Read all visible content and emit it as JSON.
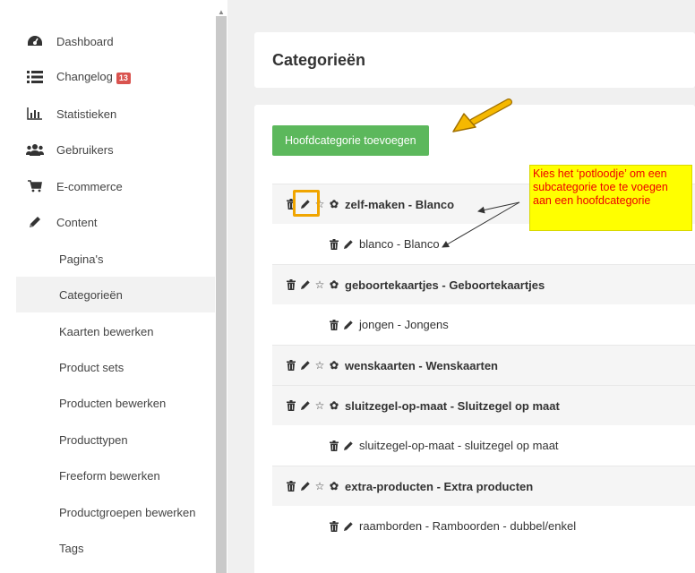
{
  "sidebar": {
    "items": [
      {
        "label": "Dashboard",
        "icon": "dashboard-icon"
      },
      {
        "label": "Changelog",
        "icon": "list-icon",
        "badge": "13"
      },
      {
        "label": "Statistieken",
        "icon": "bar-chart-icon"
      },
      {
        "label": "Gebruikers",
        "icon": "users-icon"
      },
      {
        "label": "E-commerce",
        "icon": "cart-icon"
      },
      {
        "label": "Content",
        "icon": "pencil-icon"
      }
    ],
    "sub_items": [
      {
        "label": "Pagina's"
      },
      {
        "label": "Categorieën",
        "active": true
      },
      {
        "label": "Kaarten bewerken"
      },
      {
        "label": "Product sets"
      },
      {
        "label": "Producten bewerken"
      },
      {
        "label": "Producttypen"
      },
      {
        "label": "Freeform bewerken"
      },
      {
        "label": "Productgroepen bewerken"
      },
      {
        "label": "Tags"
      }
    ]
  },
  "main": {
    "title": "Categorieën",
    "add_button": "Hoofdcategorie toevoegen",
    "categories": [
      {
        "type": "main",
        "label": "zelf-maken - Blanco"
      },
      {
        "type": "sub",
        "label": "blanco - Blanco"
      },
      {
        "type": "main",
        "label": "geboortekaartjes - Geboortekaartjes"
      },
      {
        "type": "sub",
        "label": "jongen - Jongens"
      },
      {
        "type": "main",
        "label": "wenskaarten - Wenskaarten"
      },
      {
        "type": "main",
        "label": "sluitzegel-op-maat - Sluitzegel op maat"
      },
      {
        "type": "sub",
        "label": "sluitzegel-op-maat - sluitzegel op maat"
      },
      {
        "type": "main",
        "label": "extra-producten - Extra producten"
      },
      {
        "type": "sub",
        "label": "raamborden - Ramboorden - dubbel/enkel"
      }
    ]
  },
  "annotation": {
    "callout_text": "Kies het ‘potloodje’ om een subcategorie toe te voegen aan een hoofdcategorie",
    "callout_bg": "#ffff00",
    "callout_color": "#ee0000",
    "highlight_color": "#f0a500"
  },
  "colors": {
    "accent_green": "#5cb85c",
    "badge_red": "#d9534f"
  }
}
